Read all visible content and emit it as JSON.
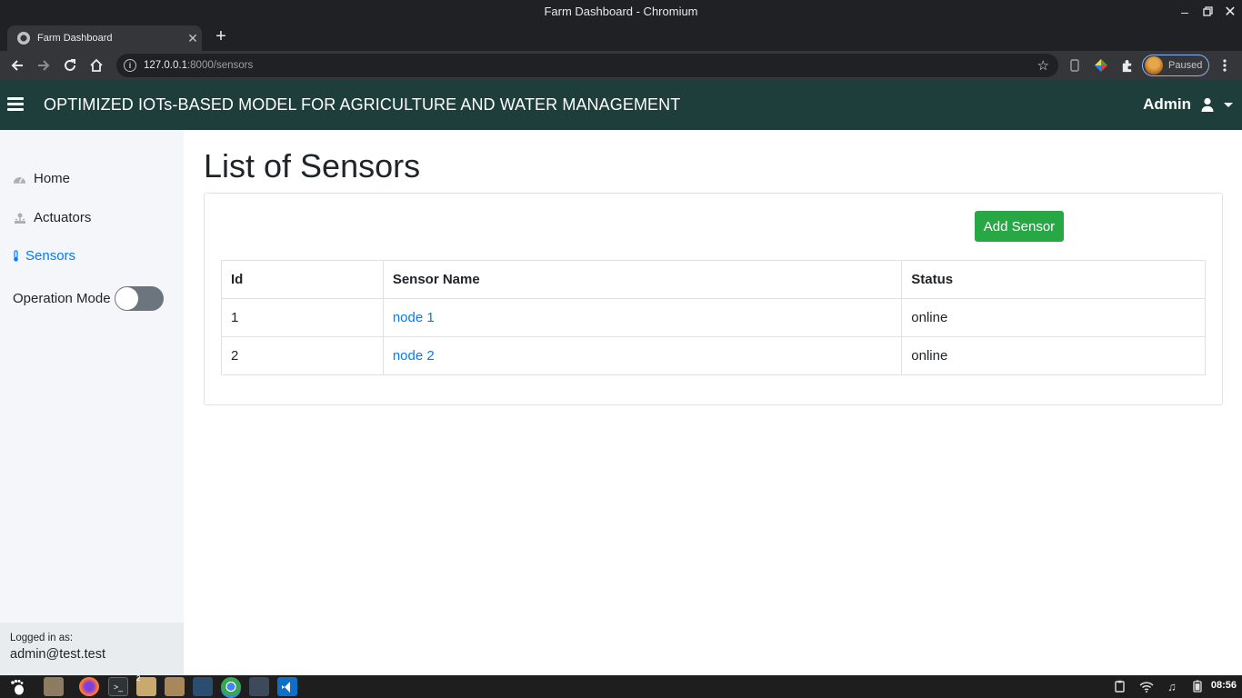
{
  "window": {
    "title": "Farm Dashboard - Chromium"
  },
  "browser": {
    "tab_title": "Farm Dashboard",
    "url_host": "127.0.0.1",
    "url_rest": ":8000/sensors",
    "profile_label": "Paused"
  },
  "navbar": {
    "brand": "OPTIMIZED IOTs-BASED MODEL FOR AGRICULTURE AND WATER MANAGEMENT",
    "user": "Admin"
  },
  "sidebar": {
    "items": [
      {
        "label": "Home",
        "icon": "tachometer-icon"
      },
      {
        "label": "Actuators",
        "icon": "sprinkler-icon"
      },
      {
        "label": "Sensors",
        "icon": "thermometer-icon",
        "active": true
      }
    ],
    "operation_mode_label": "Operation Mode",
    "operation_mode_on": false,
    "logged_in_label": "Logged in as:",
    "logged_in_email": "admin@test.test"
  },
  "main": {
    "title": "List of Sensors",
    "add_button": "Add Sensor",
    "columns": [
      "Id",
      "Sensor Name",
      "Status"
    ],
    "rows": [
      {
        "id": "1",
        "name": "node 1",
        "status": "online"
      },
      {
        "id": "2",
        "name": "node 2",
        "status": "online"
      }
    ]
  },
  "taskbar": {
    "clock": "08:56",
    "badge": "2"
  },
  "colors": {
    "navbar": "#1d3e3b",
    "accent_link": "#007bff",
    "add_button": "#28a745",
    "sidebar_bg": "#f4f6f9"
  }
}
